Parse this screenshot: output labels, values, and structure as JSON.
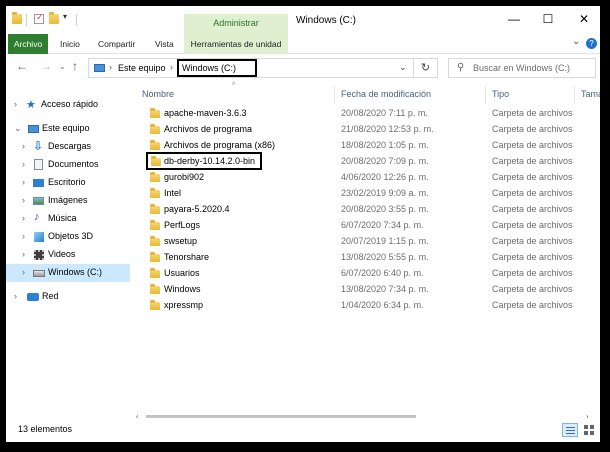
{
  "window": {
    "title": "Windows (C:)",
    "contextual_tab": "Administrar",
    "min_glyph": "—",
    "max_glyph": "☐",
    "close_glyph": "✕"
  },
  "ribbon": {
    "tabs": [
      "Archivo",
      "Inicio",
      "Compartir",
      "Vista",
      "Herramientas de unidad"
    ],
    "help_glyph": "?",
    "collapse_glyph": "⌄"
  },
  "address": {
    "breadcrumbs": [
      "Este equipo",
      "Windows (C:)"
    ],
    "separator": "›",
    "dropdown_glyph": "⌄",
    "refresh_glyph": "↻"
  },
  "nav_arrows": {
    "back": "←",
    "forward": "→",
    "recent": "⌄",
    "up": "↑"
  },
  "search": {
    "placeholder": "Buscar en Windows (C:)",
    "icon_glyph": "⚲"
  },
  "navpane": {
    "items": [
      {
        "label": "Acceso rápido",
        "icon": "star-icon",
        "chevron": "›"
      },
      {
        "label": "Este equipo",
        "icon": "computer-icon",
        "chevron": "⌄"
      },
      {
        "label": "Descargas",
        "icon": "download-icon",
        "chevron": "›"
      },
      {
        "label": "Documentos",
        "icon": "document-icon",
        "chevron": "›"
      },
      {
        "label": "Escritorio",
        "icon": "desktop-icon",
        "chevron": "›"
      },
      {
        "label": "Imágenes",
        "icon": "pictures-icon",
        "chevron": "›"
      },
      {
        "label": "Música",
        "icon": "music-icon",
        "chevron": "›"
      },
      {
        "label": "Objetos 3D",
        "icon": "cube-icon",
        "chevron": "›"
      },
      {
        "label": "Videos",
        "icon": "video-icon",
        "chevron": "›"
      },
      {
        "label": "Windows (C:)",
        "icon": "drive-icon",
        "chevron": "›",
        "selected": true
      },
      {
        "label": "Red",
        "icon": "network-icon",
        "chevron": "›"
      }
    ]
  },
  "columns": {
    "name": "Nombre",
    "date": "Fecha de modificación",
    "type": "Tipo",
    "size": "Tamaño",
    "sort_glyph": "^"
  },
  "files": [
    {
      "name": "apache-maven-3.6.3",
      "date": "20/08/2020 7:11 p. m.",
      "type": "Carpeta de archivos"
    },
    {
      "name": "Archivos de programa",
      "date": "21/08/2020 12:53 p. m.",
      "type": "Carpeta de archivos"
    },
    {
      "name": "Archivos de programa (x86)",
      "date": "18/08/2020 1:05 p. m.",
      "type": "Carpeta de archivos"
    },
    {
      "name": "db-derby-10.14.2.0-bin",
      "date": "20/08/2020 7:09 p. m.",
      "type": "Carpeta de archivos",
      "highlight": true
    },
    {
      "name": "gurobi902",
      "date": "4/06/2020 12:26 p. m.",
      "type": "Carpeta de archivos"
    },
    {
      "name": "Intel",
      "date": "23/02/2019 9:09 a. m.",
      "type": "Carpeta de archivos"
    },
    {
      "name": "payara-5.2020.4",
      "date": "20/08/2020 3:55 p. m.",
      "type": "Carpeta de archivos"
    },
    {
      "name": "PerfLogs",
      "date": "6/07/2020 7:34 p. m.",
      "type": "Carpeta de archivos"
    },
    {
      "name": "swsetup",
      "date": "20/07/2019 1:15 p. m.",
      "type": "Carpeta de archivos"
    },
    {
      "name": "Tenorshare",
      "date": "13/08/2020 5:55 p. m.",
      "type": "Carpeta de archivos"
    },
    {
      "name": "Usuarios",
      "date": "6/07/2020 6:40 p. m.",
      "type": "Carpeta de archivos"
    },
    {
      "name": "Windows",
      "date": "13/08/2020 7:34 p. m.",
      "type": "Carpeta de archivos"
    },
    {
      "name": "xpressmp",
      "date": "1/04/2020 6:34 p. m.",
      "type": "Carpeta de archivos"
    }
  ],
  "status": {
    "count": "13 elementos"
  },
  "scrollbar": {
    "left_glyph": "‹",
    "right_glyph": "›"
  }
}
